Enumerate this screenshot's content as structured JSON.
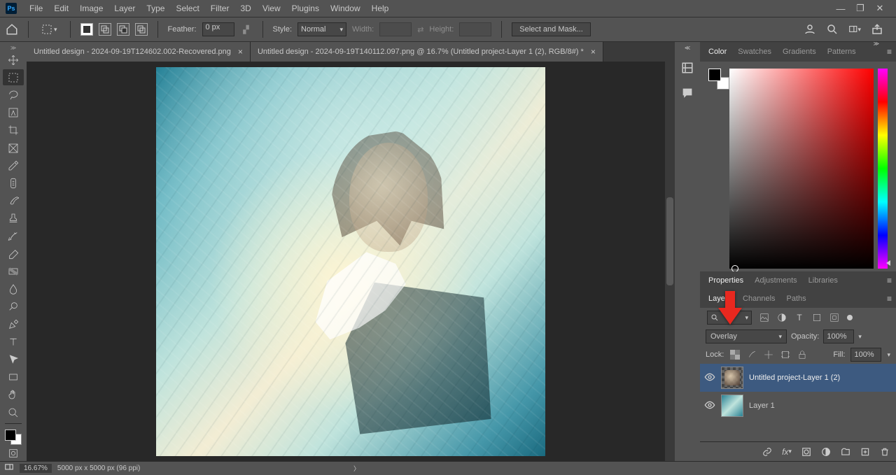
{
  "menu": {
    "items": [
      "File",
      "Edit",
      "Image",
      "Layer",
      "Type",
      "Select",
      "Filter",
      "3D",
      "View",
      "Plugins",
      "Window",
      "Help"
    ]
  },
  "options": {
    "feather_label": "Feather:",
    "feather_value": "0 px",
    "style_label": "Style:",
    "style_value": "Normal",
    "width_label": "Width:",
    "height_label": "Height:",
    "select_mask_label": "Select and Mask..."
  },
  "tabs": {
    "0": {
      "title": "Untitled design - 2024-09-19T124602.002-Recovered.png"
    },
    "1": {
      "title": "Untitled design - 2024-09-19T140112.097.png @ 16.7% (Untitled project-Layer 1 (2), RGB/8#) *"
    }
  },
  "status": {
    "zoom": "16.67%",
    "dims": "5000 px x 5000 px (96 ppi)"
  },
  "panels": {
    "color_tabs": {
      "t0": "Color",
      "t1": "Swatches",
      "t2": "Gradients",
      "t3": "Patterns"
    },
    "prop_tabs": {
      "t0": "Properties",
      "t1": "Adjustments",
      "t2": "Libraries"
    },
    "layer_tabs": {
      "t0": "Layers",
      "t1": "Channels",
      "t2": "Paths"
    }
  },
  "layers": {
    "blend_mode": "Overlay",
    "opacity_label": "Opacity:",
    "opacity_value": "100%",
    "lock_label": "Lock:",
    "fill_label": "Fill:",
    "fill_value": "100%",
    "rows": {
      "0": {
        "name": "Untitled project-Layer 1 (2)"
      },
      "1": {
        "name": "Layer 1"
      }
    }
  }
}
